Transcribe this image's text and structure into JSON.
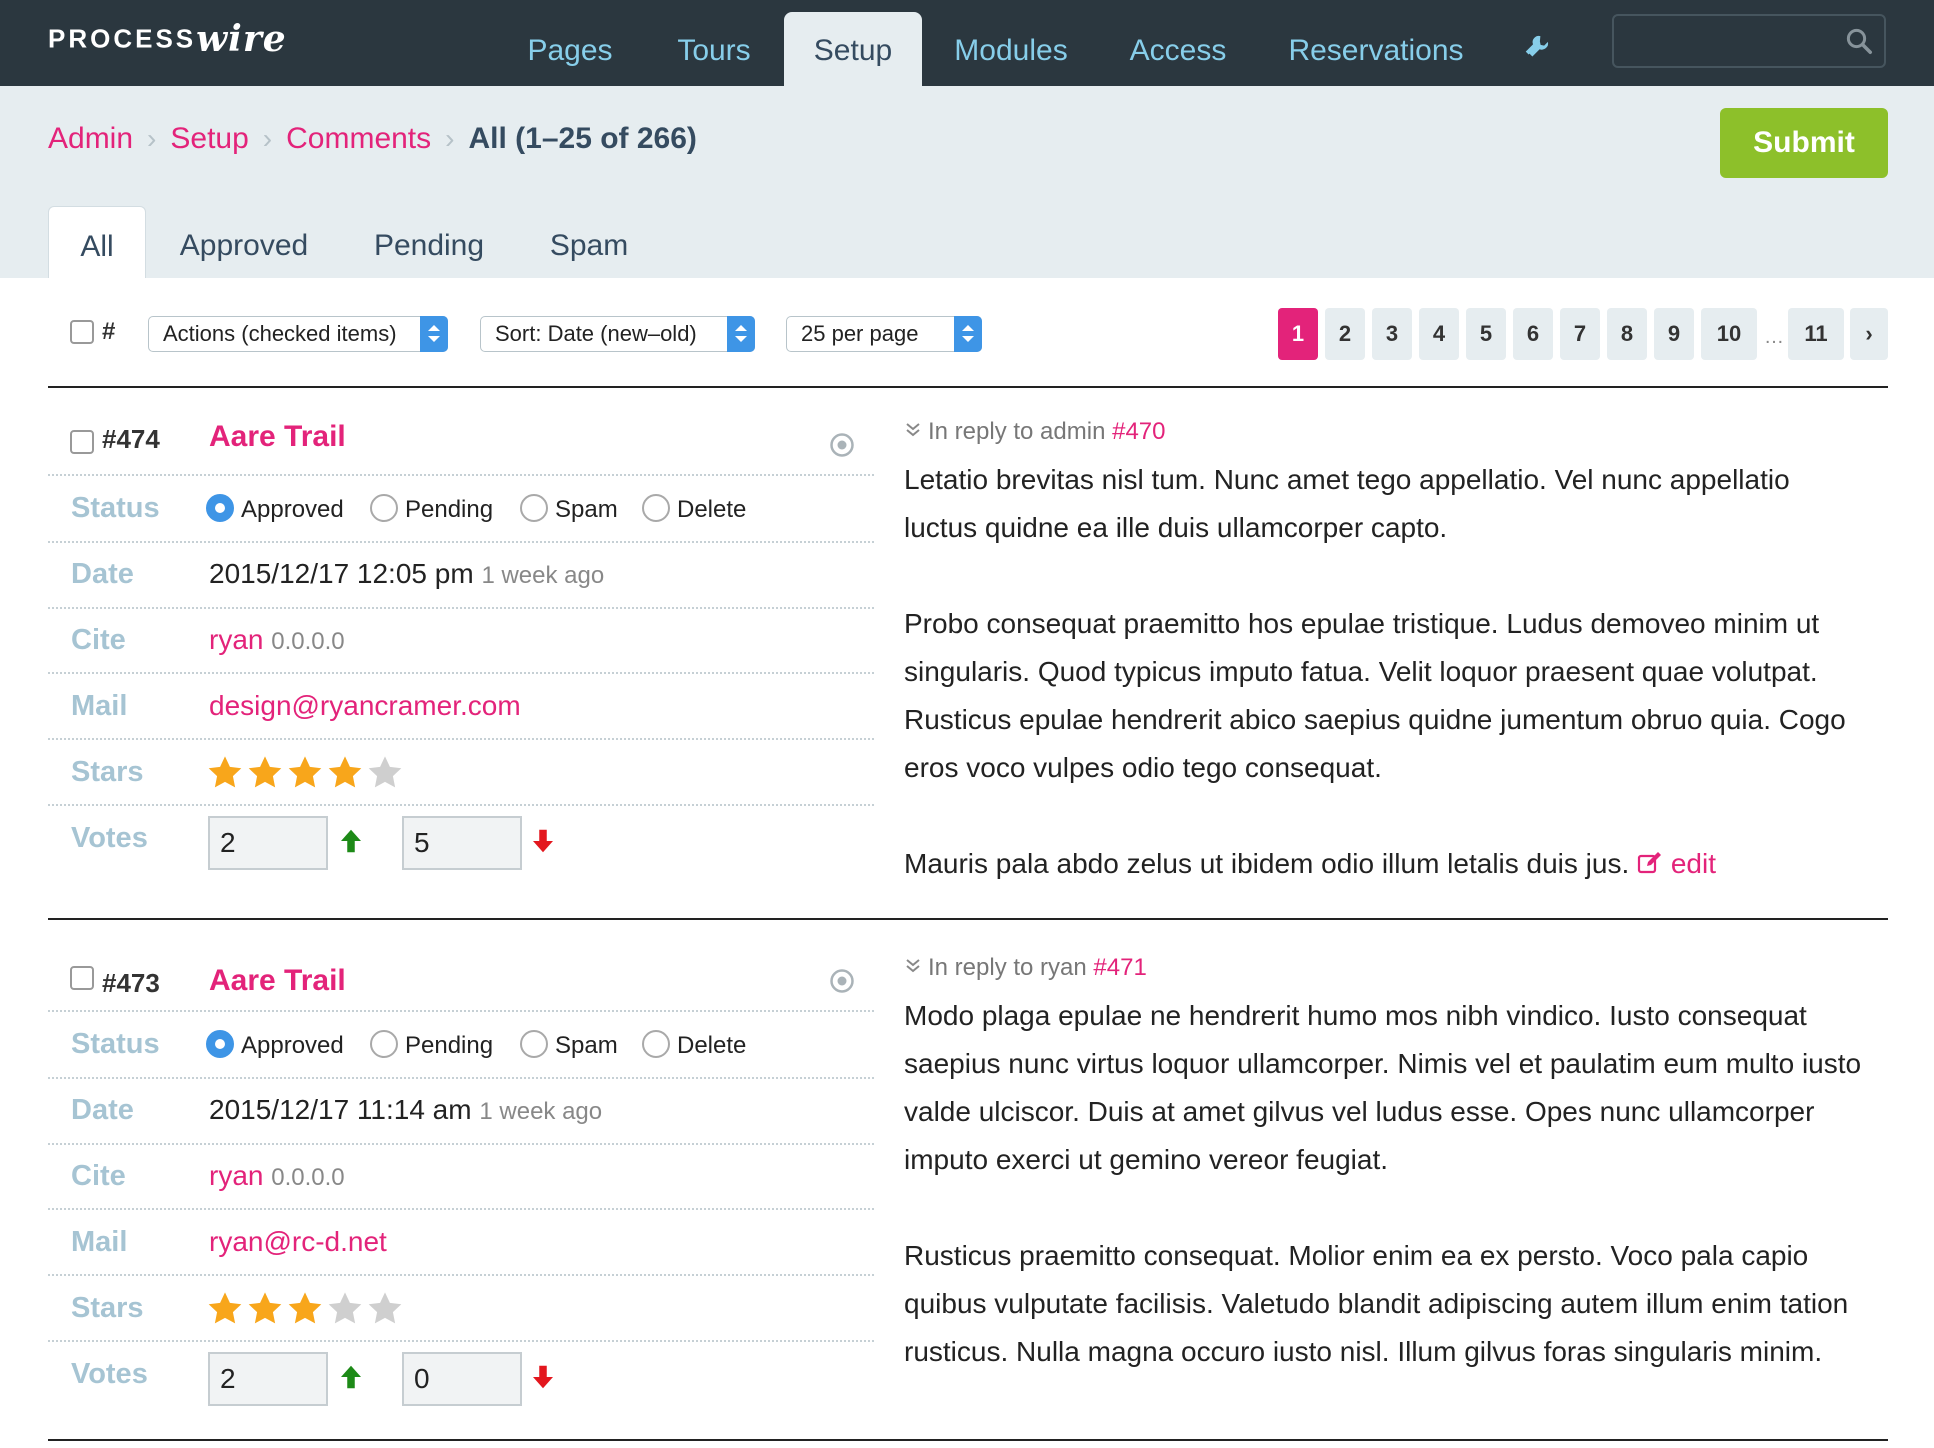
{
  "app": {
    "logo_part1": "PROCESS",
    "logo_part2": "wire"
  },
  "nav": {
    "items": [
      "Pages",
      "Tours",
      "Setup",
      "Modules",
      "Access",
      "Reservations"
    ],
    "active": "Setup",
    "tools_icon": "wrench-icon",
    "search_placeholder": "",
    "search_icon": "search-icon"
  },
  "breadcrumb": {
    "items": [
      "Admin",
      "Setup",
      "Comments"
    ],
    "current": "All (1–25 of 266)"
  },
  "submit_label": "Submit",
  "tabs": [
    "All",
    "Approved",
    "Pending",
    "Spam"
  ],
  "toolbar": {
    "hash_label": "#",
    "actions_label": "Actions (checked items)",
    "sort_label": "Sort: Date (new–old)",
    "per_page_label": "25 per page"
  },
  "pagination": {
    "pages": [
      "1",
      "2",
      "3",
      "4",
      "5",
      "6",
      "7",
      "8",
      "9",
      "10",
      "11"
    ],
    "current": "1",
    "ellipsis": "…",
    "next_icon": "chevron-right-icon"
  },
  "field_labels": {
    "status": "Status",
    "date": "Date",
    "cite": "Cite",
    "mail": "Mail",
    "stars": "Stars",
    "votes": "Votes"
  },
  "status_options": [
    "Approved",
    "Pending",
    "Spam",
    "Delete"
  ],
  "comments": [
    {
      "id": "#474",
      "title": "Aare Trail",
      "status": "Approved",
      "date": "2015/12/17 12:05 pm",
      "date_ago": "1 week ago",
      "cite_name": "ryan",
      "cite_ip": "0.0.0.0",
      "mail": "design@ryancramer.com",
      "stars": 4,
      "stars_max": 5,
      "upvotes": "2",
      "downvotes": "5",
      "reply_prefix": "In reply to admin",
      "reply_ref": "#470",
      "paragraphs": [
        "Letatio brevitas nisl tum. Nunc amet tego appellatio. Vel nunc appellatio luctus quidne ea ille duis ullamcorper capto.",
        "Probo consequat praemitto hos epulae tristique. Ludus demoveo minim ut singularis. Quod typicus imputo fatua. Velit loquor praesent quae volutpat. Rusticus epulae hendrerit abico saepius quidne jumentum obruo quia. Cogo eros voco vulpes odio tego consequat.",
        "Mauris pala abdo zelus ut ibidem odio illum letalis duis jus."
      ],
      "edit_label": "edit"
    },
    {
      "id": "#473",
      "title": "Aare Trail",
      "status": "Approved",
      "date": "2015/12/17 11:14 am",
      "date_ago": "1 week ago",
      "cite_name": "ryan",
      "cite_ip": "0.0.0.0",
      "mail": "ryan@rc-d.net",
      "stars": 3,
      "stars_max": 5,
      "upvotes": "2",
      "downvotes": "0",
      "reply_prefix": "In reply to ryan",
      "reply_ref": "#471",
      "paragraphs": [
        "Modo plaga epulae ne hendrerit humo mos nibh vindico. Iusto consequat saepius nunc virtus loquor ullamcorper. Nimis vel et paulatim eum multo iusto valde ulciscor. Duis at amet gilvus vel ludus esse. Opes nunc ullamcorper imputo exerci ut gemino vereor feugiat.",
        "Rusticus praemitto consequat. Molior enim ea ex persto. Voco pala capio quibus vulputate facilisis. Valetudo blandit adipiscing autem illum enim tation rusticus. Nulla magna occuro iusto nisl. Illum gilvus foras singularis minim."
      ]
    }
  ],
  "colors": {
    "topbar": "#2b373f",
    "nav_link": "#87ceea",
    "accent_pink": "#e3237a",
    "submit_green": "#8dc02a",
    "header_band": "#e6edf0",
    "field_label": "#a6c4d3",
    "radio_blue": "#3e95e6",
    "star_on": "#f8a61b",
    "star_off": "#cfcfcf",
    "vote_up": "#1d8a17",
    "vote_down": "#e3171e"
  }
}
